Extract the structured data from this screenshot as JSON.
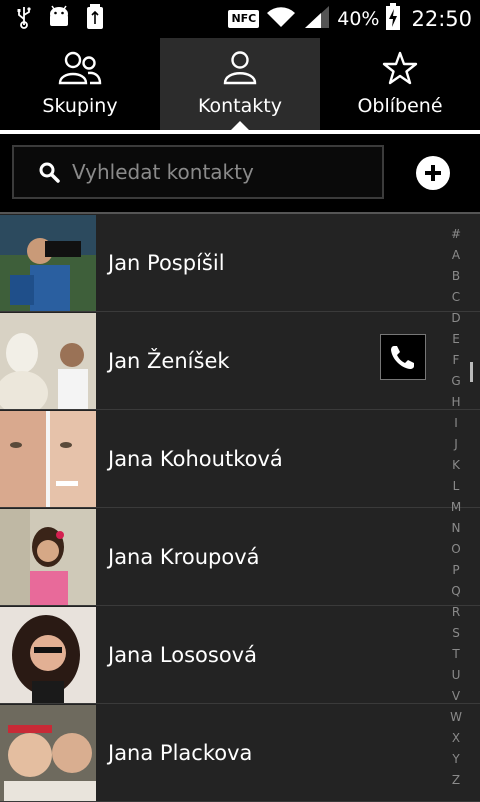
{
  "status": {
    "battery_percent": "40%",
    "time": "22:50",
    "nfc_label": "NFC"
  },
  "tabs": [
    {
      "label": "Skupiny",
      "icon": "groups-icon",
      "active": false
    },
    {
      "label": "Kontakty",
      "icon": "person-icon",
      "active": true
    },
    {
      "label": "Oblíbené",
      "icon": "star-icon",
      "active": false
    }
  ],
  "search": {
    "placeholder": "Vyhledat kontakty",
    "value": ""
  },
  "contacts": [
    {
      "name": "Jan Pospíšil"
    },
    {
      "name": "Jan Ženíšek",
      "call_button": true
    },
    {
      "name": "Jana Kohoutková"
    },
    {
      "name": "Jana Kroupová"
    },
    {
      "name": "Jana Lososová"
    },
    {
      "name": "Jana Plackova"
    }
  ],
  "alphabet": [
    "#",
    "A",
    "B",
    "C",
    "D",
    "E",
    "F",
    "G",
    "H",
    "I",
    "J",
    "K",
    "L",
    "M",
    "N",
    "O",
    "P",
    "Q",
    "R",
    "S",
    "T",
    "U",
    "V",
    "W",
    "X",
    "Y",
    "Z"
  ],
  "colors": {
    "background": "#1e1e1e",
    "tab_active": "#2c2c2c",
    "text": "#ffffff"
  }
}
